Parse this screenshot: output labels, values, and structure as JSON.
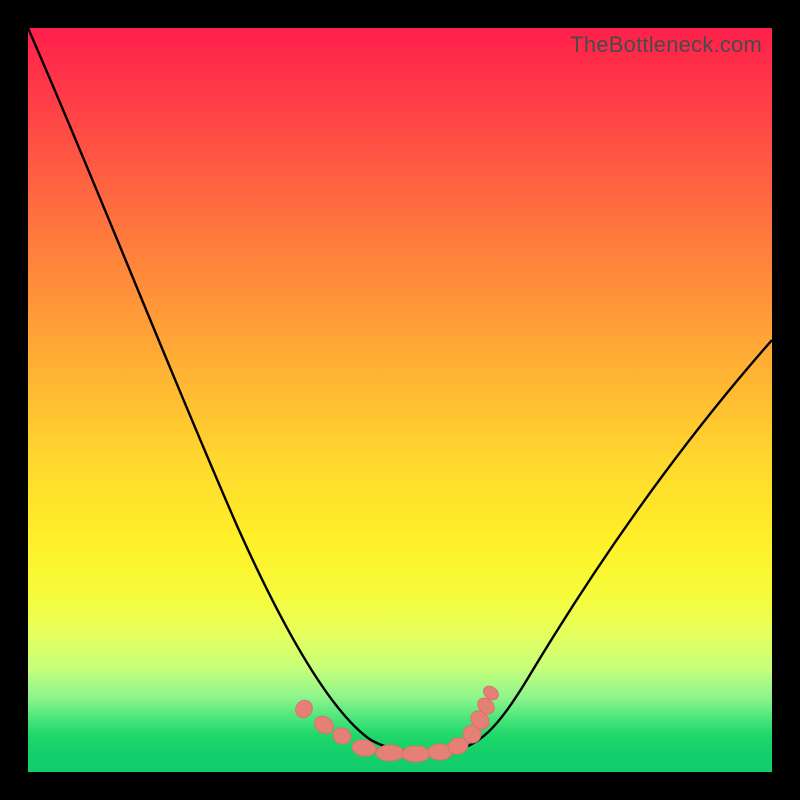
{
  "watermark": "TheBottleneck.com",
  "chart_data": {
    "type": "line",
    "title": "",
    "xlabel": "",
    "ylabel": "",
    "xlim": [
      0,
      1
    ],
    "ylim": [
      0,
      1
    ],
    "grid": false,
    "legend": false,
    "series": [
      {
        "name": "bottleneck-curve",
        "color": "#000000",
        "x": [
          0.0,
          0.05,
          0.1,
          0.15,
          0.2,
          0.25,
          0.3,
          0.35,
          0.4,
          0.44,
          0.48,
          0.5,
          0.52,
          0.55,
          0.58,
          0.6,
          0.65,
          0.7,
          0.75,
          0.8,
          0.85,
          0.9,
          0.95,
          1.0
        ],
        "y": [
          1.0,
          0.86,
          0.72,
          0.59,
          0.47,
          0.36,
          0.26,
          0.18,
          0.1,
          0.05,
          0.02,
          0.02,
          0.02,
          0.02,
          0.03,
          0.04,
          0.08,
          0.14,
          0.21,
          0.29,
          0.37,
          0.45,
          0.52,
          0.58
        ]
      },
      {
        "name": "near-bottom-markers",
        "color": "#e58077",
        "kind": "scatter",
        "x": [
          0.37,
          0.4,
          0.42,
          0.45,
          0.48,
          0.5,
          0.52,
          0.55,
          0.57,
          0.58,
          0.6,
          0.605,
          0.61
        ],
        "y": [
          0.085,
          0.065,
          0.05,
          0.025,
          0.02,
          0.018,
          0.018,
          0.02,
          0.025,
          0.04,
          0.06,
          0.08,
          0.095
        ]
      }
    ],
    "background_gradient": {
      "stops": [
        {
          "pos": 0.0,
          "color": "#ff1f4b"
        },
        {
          "pos": 0.69,
          "color": "#fff028"
        },
        {
          "pos": 1.0,
          "color": "#12cc6c"
        }
      ]
    }
  }
}
